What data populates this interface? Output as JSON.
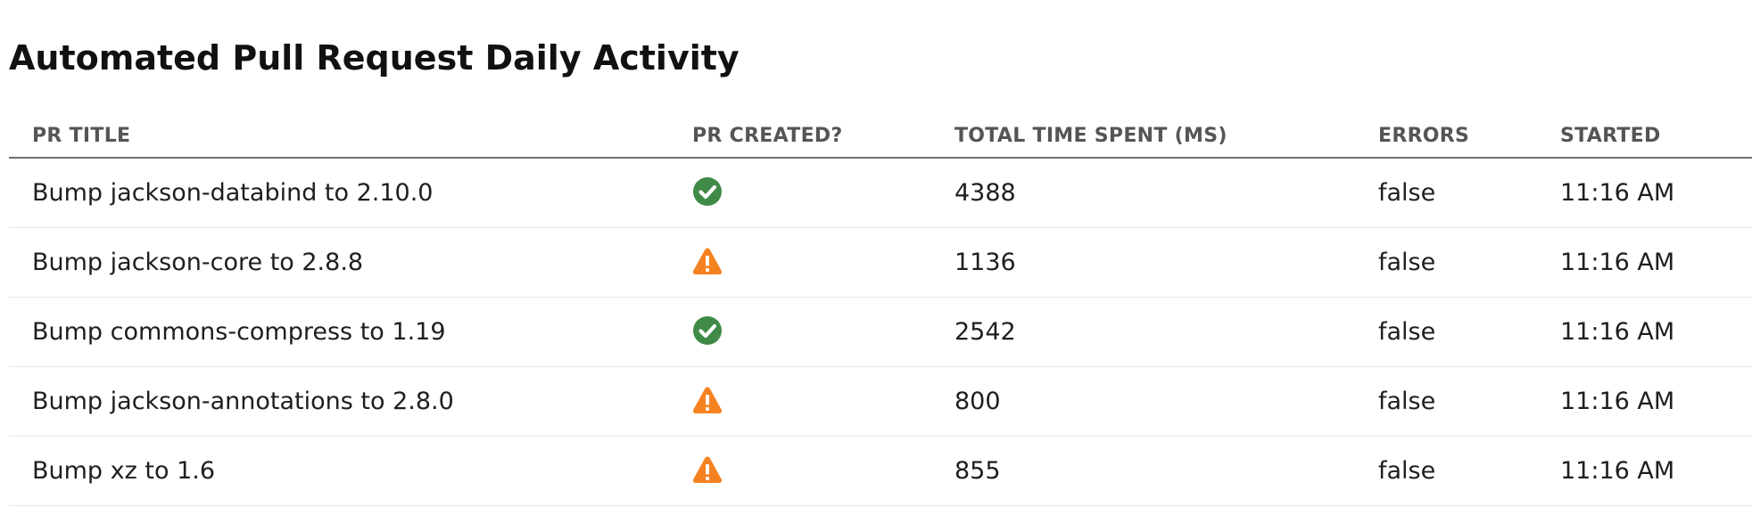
{
  "page": {
    "title": "Automated Pull Request Daily Activity"
  },
  "table": {
    "columns": [
      "PR TITLE",
      "PR CREATED?",
      "TOTAL TIME SPENT (MS)",
      "ERRORS",
      "STARTED"
    ],
    "rows": [
      {
        "title": "Bump jackson-databind to 2.10.0",
        "created_icon": "check-circle-icon",
        "time_ms": "4388",
        "errors": "false",
        "started": "11:16 AM"
      },
      {
        "title": "Bump jackson-core to 2.8.8",
        "created_icon": "warning-triangle-icon",
        "time_ms": "1136",
        "errors": "false",
        "started": "11:16 AM"
      },
      {
        "title": "Bump commons-compress to 1.19",
        "created_icon": "check-circle-icon",
        "time_ms": "2542",
        "errors": "false",
        "started": "11:16 AM"
      },
      {
        "title": "Bump jackson-annotations to 2.8.0",
        "created_icon": "warning-triangle-icon",
        "time_ms": "800",
        "errors": "false",
        "started": "11:16 AM"
      },
      {
        "title": "Bump xz to 1.6",
        "created_icon": "warning-triangle-icon",
        "time_ms": "855",
        "errors": "false",
        "started": "11:16 AM"
      }
    ]
  },
  "colors": {
    "success": "#3f8a46",
    "warning": "#f58220"
  }
}
